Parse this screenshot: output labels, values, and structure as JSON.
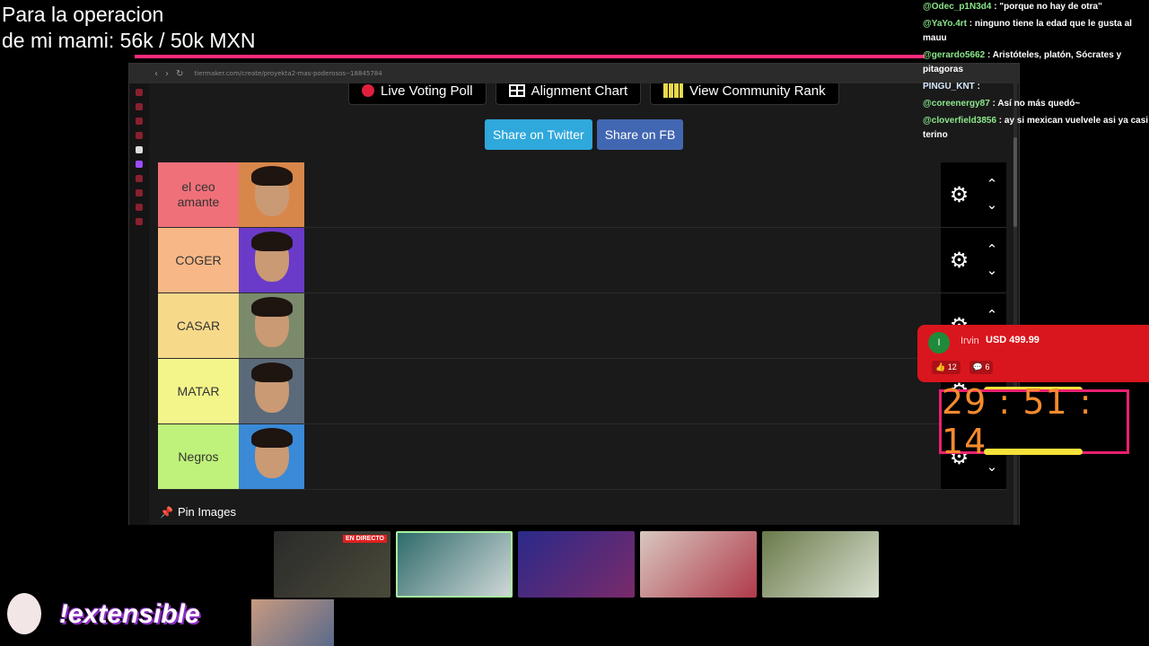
{
  "overlay": {
    "goal_line1": "Para la operacion",
    "goal_line2": "de mi mami: 56k / 50k MXN"
  },
  "browser": {
    "url": "tiermaker.com/create/proyekta2-mas-poderosos--18845784"
  },
  "tiermaker": {
    "buttons": {
      "live_voting": "Live Voting Poll",
      "alignment": "Alignment Chart",
      "community_rank": "View Community Rank"
    },
    "share": {
      "twitter": "Share on Twitter",
      "facebook": "Share on FB"
    },
    "tiers": [
      {
        "label": "el ceo amante",
        "color": "#f0707a",
        "img_bg": "#d8874a"
      },
      {
        "label": "COGER",
        "color": "#f7b786",
        "img_bg": "#6a3bc8"
      },
      {
        "label": "CASAR",
        "color": "#f7d98a",
        "img_bg": "#7a8a6a"
      },
      {
        "label": "MATAR",
        "color": "#f3f58a",
        "img_bg": "#5a6a7a"
      },
      {
        "label": "Negros",
        "color": "#bff27a",
        "img_bg": "#3a8ad8"
      }
    ],
    "pin_label": "Pin Images"
  },
  "chat": [
    {
      "user": "@Odec_p1N3d4",
      "text": " : \"porque no hay de otra\""
    },
    {
      "user": "@YaYo.4rt",
      "text": " : ninguno tiene la edad que le gusta al mauu"
    },
    {
      "user": "@gerardo5662",
      "text": " : Aristóteles, platón, Sócrates y pitagoras"
    },
    {
      "user": "PINGU_KNT",
      "text": " :"
    },
    {
      "user": "@coreenergy87",
      "text": " : Así no más quedó~"
    },
    {
      "user": "@cloverfield3856",
      "text": " : ay si mexican vuelvele asi ya casi terino"
    }
  ],
  "donation": {
    "avatar_letter": "I",
    "name": "Irvin",
    "amount": "USD 499.99",
    "likes": "12",
    "comments": "6"
  },
  "timer": {
    "value": "29 : 51 : 14"
  },
  "bottom": {
    "live_badge": "EN DIRECTO",
    "brand": "!extensible"
  },
  "colors": {
    "accent": "#e9206f",
    "twitter": "#2fa8db",
    "facebook": "#4267b2",
    "donation_bg": "#d9161d",
    "timer_text": "#f68b2d"
  }
}
